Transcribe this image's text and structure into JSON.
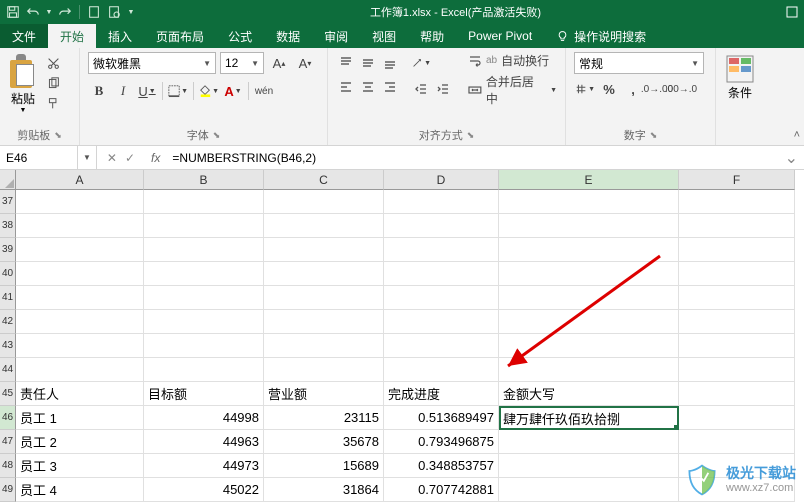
{
  "title": "工作簿1.xlsx - Excel(产品激活失败)",
  "tabs": {
    "file": "文件",
    "home": "开始",
    "insert": "插入",
    "layout": "页面布局",
    "formulas": "公式",
    "data": "数据",
    "review": "审阅",
    "view": "视图",
    "help": "帮助",
    "power": "Power Pivot",
    "tellme": "操作说明搜索"
  },
  "ribbon": {
    "clipboard": {
      "paste": "粘贴",
      "group": "剪贴板"
    },
    "font": {
      "name": "微软雅黑",
      "size": "12",
      "bold": "B",
      "italic": "I",
      "underline": "U",
      "wen": "wén",
      "group": "字体"
    },
    "align": {
      "wrap": "自动换行",
      "merge": "合并后居中",
      "group": "对齐方式"
    },
    "number": {
      "format": "常规",
      "group": "数字"
    },
    "cond": {
      "label": "条件"
    }
  },
  "namebox": "E46",
  "formula": "=NUMBERSTRING(B46,2)",
  "columns": [
    "A",
    "B",
    "C",
    "D",
    "E",
    "F"
  ],
  "visible_rows": [
    37,
    38,
    39,
    40,
    41,
    42,
    43,
    44,
    45,
    46,
    47,
    48,
    49
  ],
  "headers": {
    "A": "责任人",
    "B": "目标额",
    "C": "营业额",
    "D": "完成进度",
    "E": "金额大写"
  },
  "rows": [
    {
      "a": "员工 1",
      "b": "44998",
      "c": "23115",
      "d": "0.513689497",
      "e": "肆万肆仟玖佰玖拾捌"
    },
    {
      "a": "员工 2",
      "b": "44963",
      "c": "35678",
      "d": "0.793496875",
      "e": ""
    },
    {
      "a": "员工 3",
      "b": "44973",
      "c": "15689",
      "d": "0.348853757",
      "e": ""
    },
    {
      "a": "员工 4",
      "b": "45022",
      "c": "31864",
      "d": "0.707742881",
      "e": ""
    }
  ],
  "selected_cell": "E46",
  "watermark": {
    "top": "极光下载站",
    "bot": "www.xz7.com"
  },
  "chart_data": {
    "type": "table",
    "title": "",
    "columns": [
      "责任人",
      "目标额",
      "营业额",
      "完成进度",
      "金额大写"
    ],
    "rows": [
      [
        "员工 1",
        44998,
        23115,
        0.513689497,
        "肆万肆仟玖佰玖拾捌"
      ],
      [
        "员工 2",
        44963,
        35678,
        0.793496875,
        ""
      ],
      [
        "员工 3",
        44973,
        15689,
        0.348853757,
        ""
      ],
      [
        "员工 4",
        45022,
        31864,
        0.707742881,
        ""
      ]
    ]
  }
}
